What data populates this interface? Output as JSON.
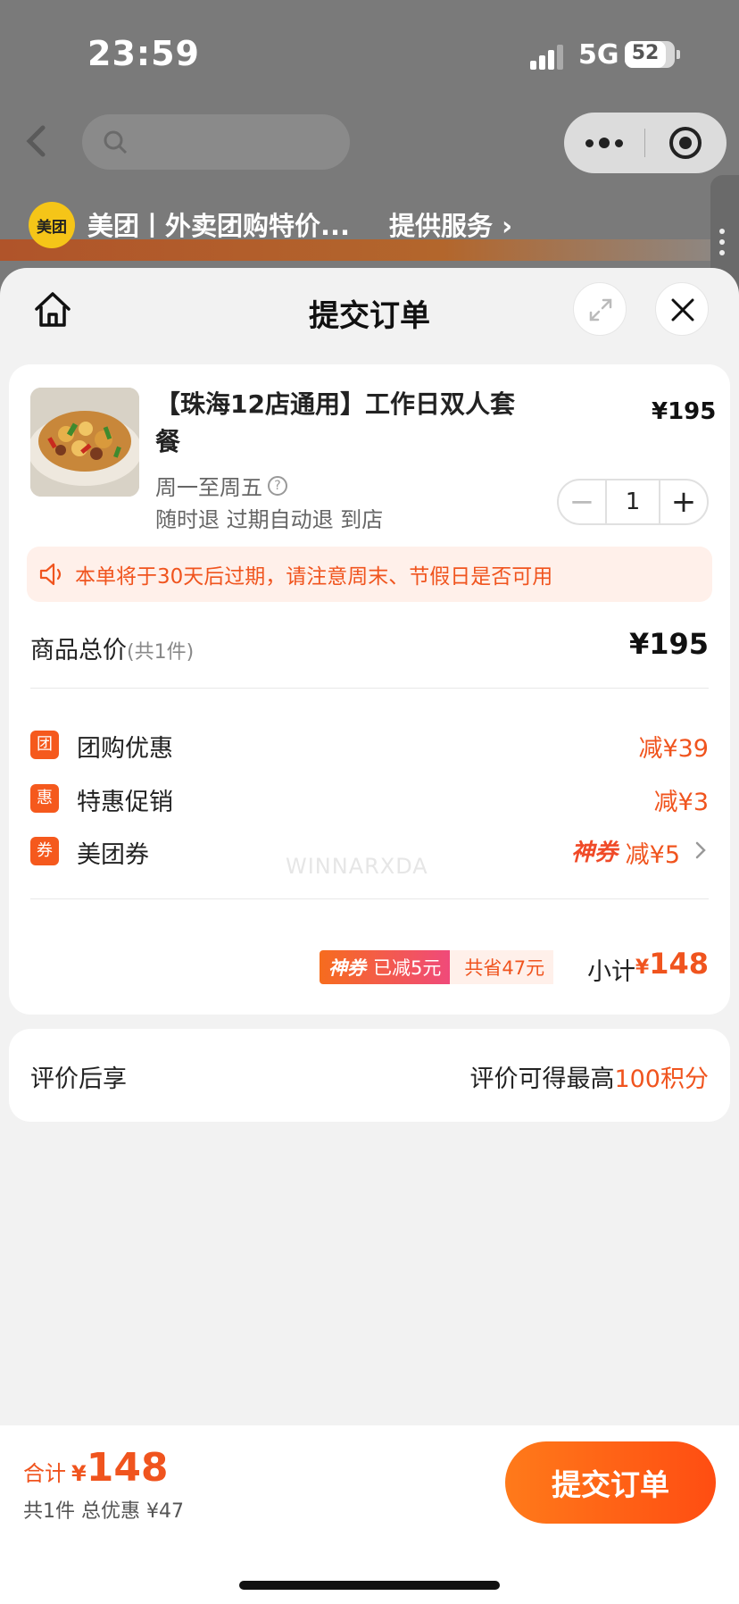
{
  "status_bar": {
    "time": "23:59",
    "network": "5G",
    "battery": "52"
  },
  "mini_program": {
    "brand_logo": "美团",
    "title": "美团丨外卖团购特价...",
    "provider_link": "提供服务 ›"
  },
  "sheet": {
    "title": "提交订单"
  },
  "order": {
    "product_name": "【珠海12店通用】工作日双人套餐",
    "price": "¥195",
    "available_days": "周一至周五",
    "tags": "随时退 过期自动退 到店",
    "quantity": "1",
    "minus_label": "−",
    "plus_label": "+",
    "notice": "本单将于30天后过期，请注意周末、节假日是否可用"
  },
  "summary": {
    "total_label": "商品总价",
    "total_count": "(共1件)",
    "total_value": "¥195",
    "discounts": [
      {
        "badge": "团",
        "label": "团购优惠",
        "value": "减¥39"
      },
      {
        "badge": "惠",
        "label": "特惠促销",
        "value": "减¥3"
      },
      {
        "badge": "券",
        "label": "美团券",
        "tag": "神券",
        "value": "减¥5"
      }
    ],
    "promo_tag": "神券",
    "promo_reduced": "已减5元",
    "promo_saved": "共省47元",
    "subtotal_label": "小计",
    "subtotal_currency": "¥",
    "subtotal_value": "148"
  },
  "watermark": "WINNARXDA",
  "review": {
    "label": "评价后享",
    "value_prefix": "评价可得最高",
    "value_highlight": "100积分"
  },
  "bottom": {
    "total_label": "合计",
    "total_currency": "¥",
    "total_value": "148",
    "meta": "共1件 总优惠 ¥47",
    "submit_label": "提交订单"
  },
  "colors": {
    "accent": "#f0541e",
    "button_gradient_start": "#ff7a1a",
    "button_gradient_end": "#ff4d12",
    "notice_bg": "#fff0ea",
    "logo_yellow": "#f5c518"
  },
  "icons": [
    "back-icon",
    "search-icon",
    "more-icon",
    "target-icon",
    "home-icon",
    "expand-icon",
    "close-icon",
    "help-icon",
    "speaker-icon",
    "chevron-right-icon"
  ]
}
